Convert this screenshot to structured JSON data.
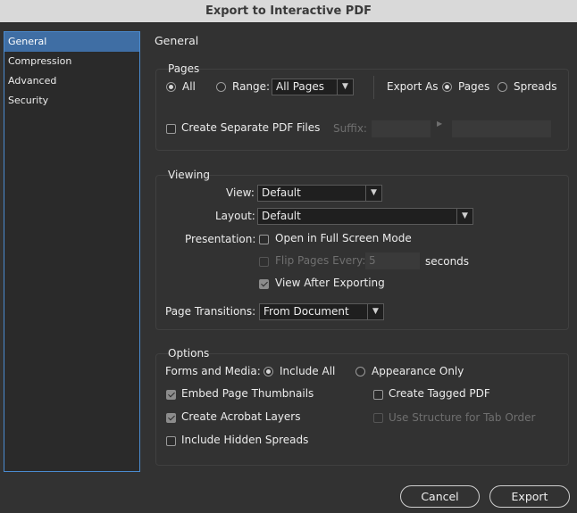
{
  "window": {
    "title": "Export to Interactive PDF"
  },
  "sidebar": {
    "items": [
      {
        "label": "General",
        "selected": true
      },
      {
        "label": "Compression",
        "selected": false
      },
      {
        "label": "Advanced",
        "selected": false
      },
      {
        "label": "Security",
        "selected": false
      }
    ]
  },
  "main": {
    "title": "General"
  },
  "pages": {
    "group_label": "Pages",
    "all_label": "All",
    "range_label": "Range:",
    "range_value": "All Pages",
    "export_as_label": "Export As",
    "export_pages_label": "Pages",
    "export_spreads_label": "Spreads",
    "separate_files_label": "Create Separate PDF Files",
    "suffix_label": "Suffix:",
    "suffix_value": "",
    "suffix_value2": ""
  },
  "viewing": {
    "group_label": "Viewing",
    "view_label": "View:",
    "view_value": "Default",
    "layout_label": "Layout:",
    "layout_value": "Default",
    "presentation_label": "Presentation:",
    "full_screen_label": "Open in Full Screen Mode",
    "flip_label": "Flip Pages Every:",
    "flip_value": "5",
    "seconds_label": "seconds",
    "view_after_label": "View After Exporting",
    "transitions_label": "Page Transitions:",
    "transitions_value": "From Document"
  },
  "options": {
    "group_label": "Options",
    "forms_label": "Forms and Media:",
    "include_all_label": "Include All",
    "appearance_only_label": "Appearance Only",
    "thumbnails_label": "Embed Page Thumbnails",
    "tagged_pdf_label": "Create Tagged PDF",
    "acrobat_layers_label": "Create Acrobat Layers",
    "tab_order_label": "Use Structure for Tab Order",
    "hidden_spreads_label": "Include Hidden Spreads"
  },
  "buttons": {
    "cancel": "Cancel",
    "export": "Export"
  },
  "colors": {
    "accent": "#3f6ea4",
    "background": "#323232",
    "titlebar": "#d9d9d9"
  }
}
